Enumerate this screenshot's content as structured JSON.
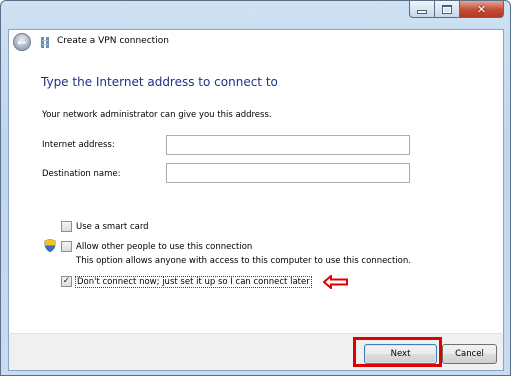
{
  "window": {
    "title": "Create a VPN connection"
  },
  "caption_buttons": {
    "minimize_icon": "minimize-icon",
    "maximize_icon": "maximize-icon",
    "close_glyph": "✕"
  },
  "navigation": {
    "back_glyph": "←"
  },
  "page": {
    "heading": "Type the Internet address to connect to",
    "instruction": "Your network administrator can give you this address."
  },
  "form": {
    "internet_address": {
      "label": "Internet address:",
      "value": "",
      "placeholder": ""
    },
    "destination_name": {
      "label": "Destination name:",
      "value": "",
      "placeholder": ""
    }
  },
  "options": {
    "smart_card": {
      "label": "Use a smart card",
      "checked": false
    },
    "allow_others": {
      "label": "Allow other people to use this connection",
      "description": "This option allows anyone with access to this computer to use this connection.",
      "checked": false,
      "icon": "uac-shield-icon"
    },
    "dont_connect": {
      "label": "Don't connect now; just set it up so I can connect later",
      "checked": true,
      "check_glyph": "✓"
    }
  },
  "buttons": {
    "next": "Next",
    "cancel": "Cancel"
  },
  "annotations": {
    "highlight_color": "#e00000"
  }
}
